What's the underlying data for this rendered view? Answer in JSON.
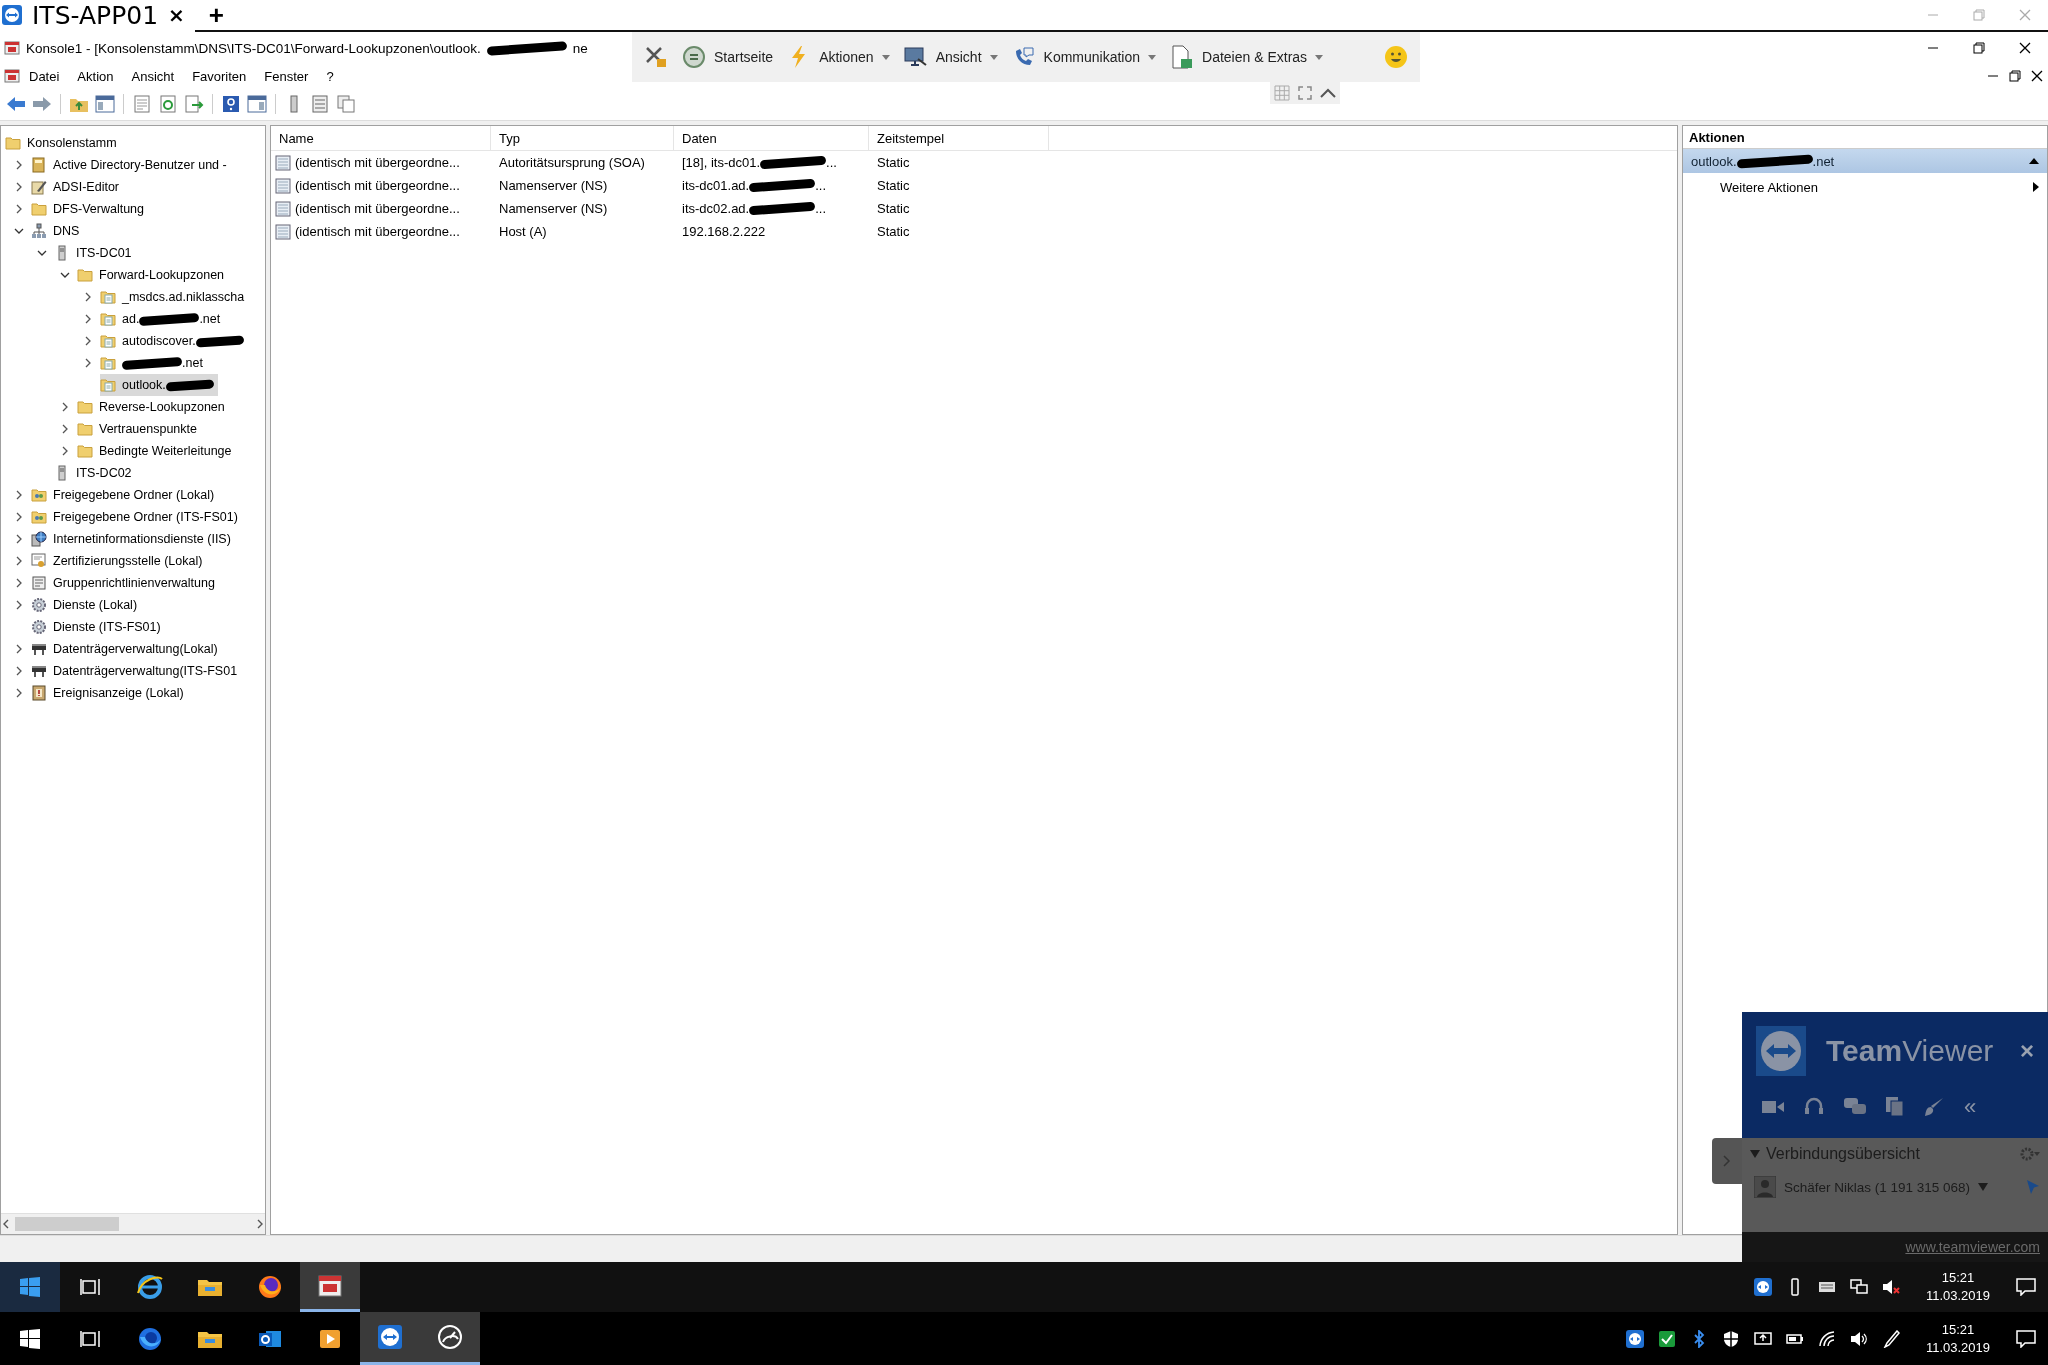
{
  "tab_bar": {
    "tabs": [
      {
        "label": "ITS-APP01",
        "selected": true,
        "close": "×"
      }
    ],
    "new_tab": "+"
  },
  "window": {
    "title": "Konsole1 - [Konsolenstamm\\DNS\\ITS-DC01\\Forward-Lookupzonen\\outlook.",
    "title_redacted": true,
    "title_tail": "ne"
  },
  "remote_toolbar": {
    "items": [
      {
        "kind": "home",
        "label": "Startseite",
        "dropdown": false
      },
      {
        "kind": "lightning",
        "label": "Aktionen",
        "dropdown": true
      },
      {
        "kind": "monitor",
        "label": "Ansicht",
        "dropdown": true
      },
      {
        "kind": "phone",
        "label": "Kommunikation",
        "dropdown": true
      },
      {
        "kind": "file",
        "label": "Dateien & Extras",
        "dropdown": true
      }
    ]
  },
  "menu": [
    "Datei",
    "Aktion",
    "Ansicht",
    "Favoriten",
    "Fenster",
    "?"
  ],
  "tree": {
    "root": {
      "label": "Konsolenstamm",
      "kind": "folder",
      "selected": false,
      "children": [
        {
          "label": "Active Directory-Benutzer und -",
          "kind": "book",
          "selected": false,
          "expanded": false
        },
        {
          "label": "ADSI-Editor",
          "kind": "pencil",
          "selected": false,
          "expanded": false
        },
        {
          "label": "DFS-Verwaltung",
          "kind": "folder",
          "selected": false,
          "expanded": false
        },
        {
          "label": "DNS",
          "kind": "network",
          "selected": false,
          "expanded": true,
          "children": [
            {
              "label": "ITS-DC01",
              "kind": "server",
              "selected": false,
              "expanded": true,
              "children": [
                {
                  "label": "Forward-Lookupzonen",
                  "kind": "folder",
                  "selected": false,
                  "expanded": true,
                  "children": [
                    {
                      "label": "_msdcs.ad.niklasscha",
                      "kind": "zone",
                      "selected": false,
                      "expanded": false
                    },
                    {
                      "label": "ad.",
                      "redacted": true,
                      "label_end": ".net",
                      "kind": "zone",
                      "selected": false,
                      "expanded": false
                    },
                    {
                      "label": "autodiscover.",
                      "redacted": true,
                      "kind": "zone",
                      "selected": false,
                      "expanded": false
                    },
                    {
                      "redacted": true,
                      "label_end": ".net",
                      "kind": "zone",
                      "selected": false,
                      "expanded": false
                    },
                    {
                      "label": "outlook.",
                      "redacted": true,
                      "kind": "zone",
                      "selected": true
                    }
                  ]
                },
                {
                  "label": "Reverse-Lookupzonen",
                  "kind": "folder",
                  "selected": false,
                  "expanded": false
                },
                {
                  "label": "Vertrauenspunkte",
                  "kind": "folder",
                  "selected": false,
                  "expanded": false
                },
                {
                  "label": "Bedingte Weiterleitunge",
                  "kind": "folder",
                  "selected": false,
                  "expanded": false
                }
              ]
            },
            {
              "label": "ITS-DC02",
              "kind": "server",
              "selected": false
            }
          ]
        },
        {
          "label": "Freigegebene Ordner (Lokal)",
          "kind": "share",
          "selected": false,
          "expanded": false
        },
        {
          "label": "Freigegebene Ordner (ITS-FS01)",
          "kind": "share",
          "selected": false,
          "expanded": false
        },
        {
          "label": "Internetinformationsdienste (IIS)",
          "kind": "globe",
          "selected": false,
          "expanded": false
        },
        {
          "label": "Zertifizierungsstelle (Lokal)",
          "kind": "certificate",
          "selected": false,
          "expanded": false
        },
        {
          "label": "Gruppenrichtlinienverwaltung",
          "kind": "document",
          "selected": false,
          "expanded": false
        },
        {
          "label": "Dienste (Lokal)",
          "kind": "gear",
          "selected": false,
          "expanded": false
        },
        {
          "label": "Dienste (ITS-FS01)",
          "kind": "gear",
          "selected": false
        },
        {
          "label": "Datenträgerverwaltung(Lokal)",
          "kind": "drive",
          "selected": false,
          "expanded": false
        },
        {
          "label": "Datenträgerverwaltung(ITS-FS01",
          "kind": "drive",
          "selected": false,
          "expanded": false
        },
        {
          "label": "Ereignisanzeige (Lokal)",
          "kind": "event",
          "selected": false,
          "expanded": false
        }
      ]
    }
  },
  "table": {
    "columns": [
      "Name",
      "Typ",
      "Daten",
      "Zeitstempel"
    ],
    "rows": [
      {
        "name": "(identisch mit übergeordne...",
        "type": "Autoritätsursprung (SOA)",
        "data": {
          "text": "[18], its-dc01.",
          "redacted": true,
          "tail": "..."
        },
        "timestamp": "Static"
      },
      {
        "name": "(identisch mit übergeordne...",
        "type": "Namenserver (NS)",
        "data": {
          "text": "its-dc01.ad.",
          "redacted": true,
          "tail": "..."
        },
        "timestamp": "Static"
      },
      {
        "name": "(identisch mit übergeordne...",
        "type": "Namenserver (NS)",
        "data": {
          "text": "its-dc02.ad.",
          "redacted": true,
          "tail": "..."
        },
        "timestamp": "Static"
      },
      {
        "name": "(identisch mit übergeordne...",
        "type": "Host (A)",
        "data": {
          "text": "192.168.2.222",
          "redacted": false
        },
        "timestamp": "Static"
      }
    ]
  },
  "actions": {
    "title": "Aktionen",
    "section": {
      "label": "outlook.",
      "redacted": true,
      "label_end": ".net",
      "expanded": true
    },
    "items": [
      "Weitere Aktionen"
    ]
  },
  "teamviewer": {
    "title": "**Team**Viewer",
    "close": "×",
    "collapse": "«",
    "section": "Verbindungsübersicht",
    "section_expanded": true,
    "partner": "Schäfer Niklas (1 191 315 068)",
    "link": "www.teamviewer.com"
  },
  "remote_taskbar": {
    "apps": [
      {
        "kind": "ie",
        "selected": false
      },
      {
        "kind": "explorer",
        "selected": false
      },
      {
        "kind": "firefox",
        "selected": false
      },
      {
        "kind": "console",
        "selected": true
      }
    ],
    "time": "15:21",
    "date": "11.03.2019"
  },
  "local_taskbar": {
    "apps": [
      {
        "kind": "bluefox",
        "selected": false
      },
      {
        "kind": "explorer",
        "selected": false
      },
      {
        "kind": "mail",
        "selected": false
      },
      {
        "kind": "media",
        "selected": false
      },
      {
        "kind": "remote",
        "selected": true
      },
      {
        "kind": "gauge",
        "selected": true
      }
    ],
    "time": "15:21",
    "date": "11.03.2019"
  }
}
